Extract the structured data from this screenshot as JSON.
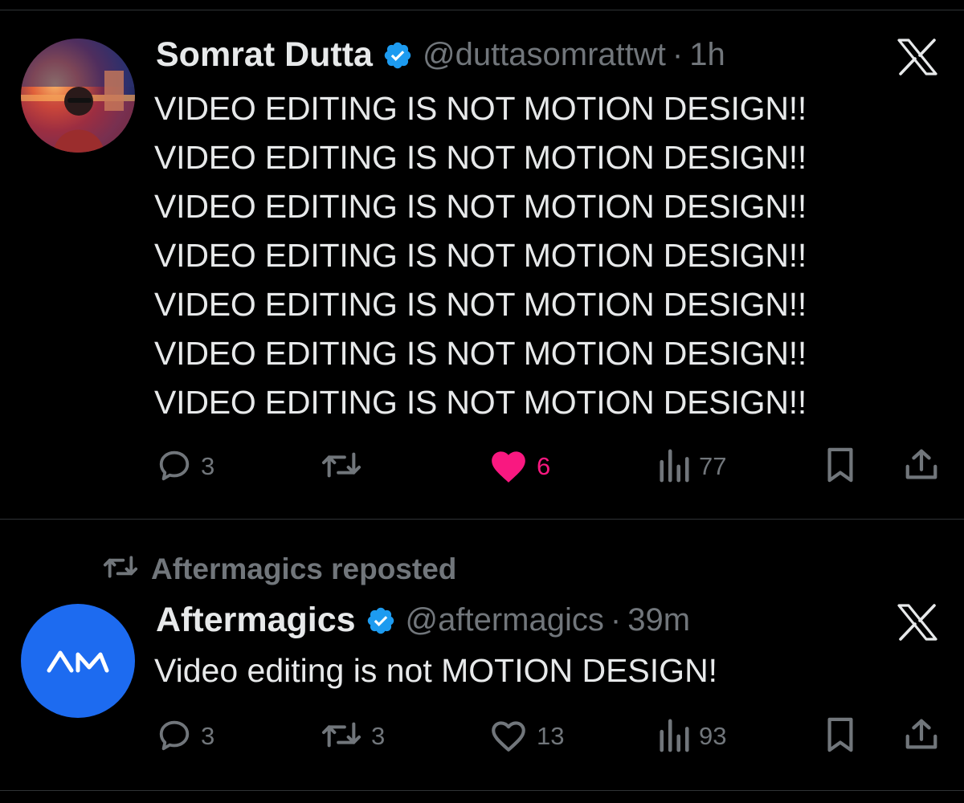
{
  "tweet1": {
    "display_name": "Somrat Dutta",
    "handle": "@duttasomrattwt",
    "separator": "·",
    "time": "1h",
    "lines": [
      "VIDEO EDITING IS NOT MOTION DESIGN!!",
      "VIDEO EDITING IS NOT MOTION DESIGN!!",
      "VIDEO EDITING IS NOT MOTION DESIGN!!",
      "VIDEO EDITING IS NOT MOTION DESIGN!!",
      "VIDEO EDITING IS NOT MOTION DESIGN!!",
      "VIDEO EDITING IS NOT MOTION DESIGN!!",
      "VIDEO EDITING IS NOT MOTION DESIGN!!"
    ],
    "actions": {
      "replies": "3",
      "reposts": "",
      "likes": "6",
      "views": "77"
    },
    "liked": true
  },
  "repost_banner": {
    "text": "Aftermagics reposted"
  },
  "tweet2": {
    "avatar_text": "AM",
    "display_name": "Aftermagics",
    "handle": "@aftermagics",
    "separator": "·",
    "time": "39m",
    "text": "Video editing is not MOTION DESIGN!",
    "actions": {
      "replies": "3",
      "reposts": "3",
      "likes": "13",
      "views": "93"
    },
    "liked": false
  },
  "icons": {
    "verified": "verified-badge-icon",
    "x_logo": "x-logo-icon",
    "reply": "reply-icon",
    "repost": "repost-icon",
    "like": "heart-icon",
    "views": "views-icon",
    "bookmark": "bookmark-icon",
    "share": "share-icon"
  },
  "colors": {
    "background": "#000000",
    "text": "#e7e9ea",
    "secondary": "#71767b",
    "verified": "#1d9bf0",
    "like_active": "#f91880",
    "am_avatar": "#1d6bf0"
  }
}
